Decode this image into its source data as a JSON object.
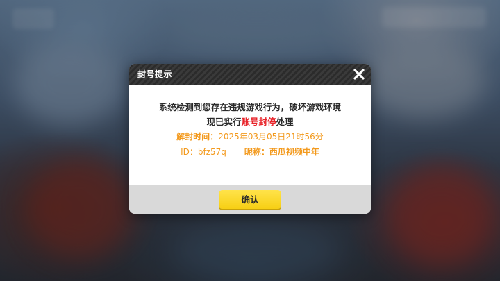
{
  "dialog": {
    "title": "封号提示",
    "message_line1": "系统检测到您存在违规游戏行为，破坏游戏环境",
    "message_line2_prefix": "现已实行",
    "message_line2_highlight": "账号封停",
    "message_line2_suffix": "处理",
    "unban_label": "解封时间：",
    "unban_time": "2025年03月05日21时56分",
    "id_label": "ID：",
    "id_value": "bfz57q",
    "nickname_label": "昵称：",
    "nickname_value": "西瓜视频中年",
    "confirm_label": "确认"
  },
  "colors": {
    "header_dark": "#2b2b2b",
    "highlight_red": "#e8242a",
    "info_orange": "#f39a1e",
    "confirm_yellow": "#f7cf14",
    "footer_gray": "#d9d9d9"
  },
  "icons": {
    "close": "close-icon"
  }
}
